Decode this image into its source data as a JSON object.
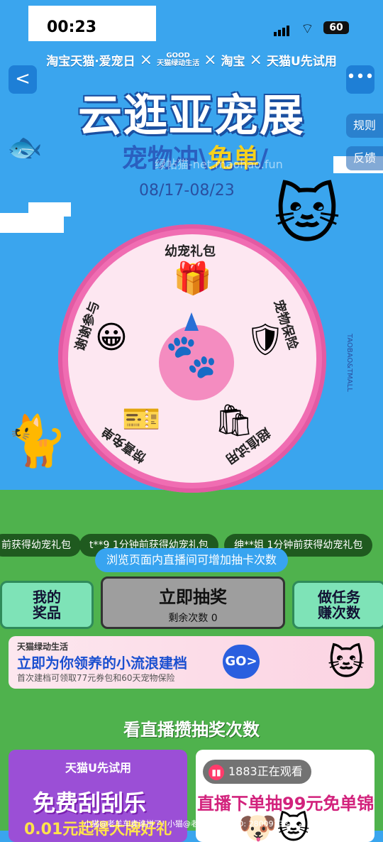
{
  "status_bar": {
    "time": "00:23",
    "battery": "60"
  },
  "brand_bar": {
    "brand1": "淘宝天猫·爱宠日",
    "x": "×",
    "brand2_top": "GOOD",
    "brand2_bottom": "天猫绿动生活",
    "brand3": "淘宝",
    "brand4": "天猫U先试用"
  },
  "nav": {
    "back": "<",
    "more": "•••"
  },
  "hero": {
    "title": "云逛亚宠展",
    "subtitle_a": "宠物冲\\",
    "subtitle_b": "免单",
    "subtitle_c": "/",
    "dates": "08/17-08/23",
    "watermark": "绿帖猫-net.maohao.fun"
  },
  "side_tabs": {
    "rules": "规则",
    "feedback": "反馈"
  },
  "wheel": {
    "segments": [
      {
        "label": "幼宠礼包",
        "icon": "gift-icon"
      },
      {
        "label": "宠物保险",
        "icon": "shield-paw-icon"
      },
      {
        "label": "超值试用",
        "icon": "bag-paw-icon"
      },
      {
        "label": "惊喜免单",
        "icon": "free-ticket-icon"
      },
      {
        "label": "谢谢参与",
        "icon": "smile-icon"
      }
    ],
    "hub_icon": "paw-icon",
    "side_text": "TAOBAO&TMALL"
  },
  "tickers": [
    "前获得幼宠礼包",
    "t**9 1分钟前获得幼宠礼包",
    "绅**姐 1分钟前获得幼宠礼包"
  ],
  "tip": "浏览页面内直播间可增加抽卡次数",
  "actions": {
    "my_prizes": "我的\n奖品",
    "draw": "立即抽奖",
    "remaining": "剩余次数 0",
    "tasks": "做任务\n赚次数"
  },
  "promo": {
    "brand": "天猫绿动生活",
    "headline": "立即为你领养的小流浪建档",
    "desc": "首次建档可领取77元券包和60天宠物保险",
    "go": "GO>"
  },
  "section_title": "看直播攒抽奖次数",
  "cards": {
    "left": {
      "brand": "天猫U先试用",
      "head": "免费刮刮乐",
      "line2": "0.01元起得大牌好礼"
    },
    "right": {
      "viewers": "1883正在观看",
      "head": "直播下单抽99元免单锦鲤"
    }
  },
  "bottom_note": "小猫@老羊车卖谁拼了!  小猫@老羊车卖谁 (ID: 28009733)",
  "colors": {
    "sky": "#3aa5ee",
    "grass": "#4fb24d",
    "wheel": "#f06db2",
    "accent": "#2a5fdf"
  }
}
